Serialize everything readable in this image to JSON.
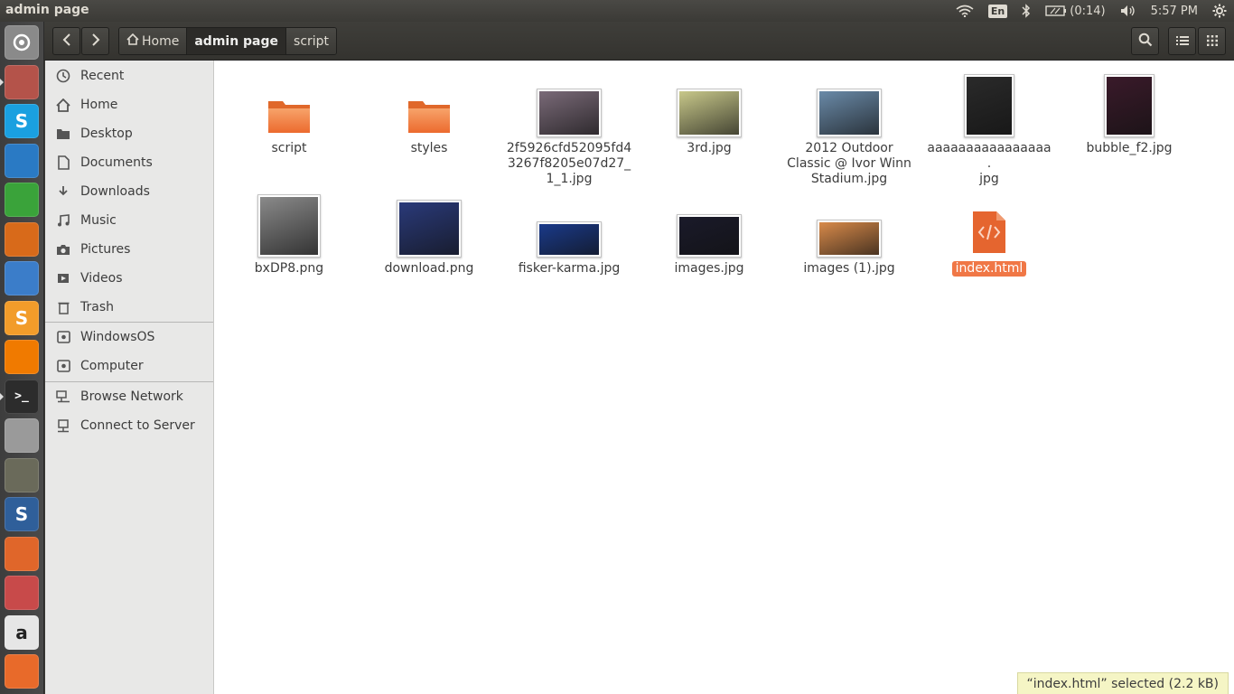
{
  "window": {
    "title": "admin page"
  },
  "panel": {
    "keyboard": "En",
    "battery": "(0:14)",
    "clock": "5:57 PM",
    "icons": [
      "wifi-icon",
      "keyboard-layout-indicator",
      "bluetooth-icon",
      "battery-icon",
      "volume-icon",
      "system-gear-icon"
    ]
  },
  "launcher": [
    {
      "name": "dash-home-icon",
      "color": "#8a8a8a",
      "glyph": ""
    },
    {
      "name": "files-icon",
      "color": "#b4534a",
      "glyph": ""
    },
    {
      "name": "skype-icon",
      "color": "#1aa0e0",
      "glyph": "S"
    },
    {
      "name": "writer-icon",
      "color": "#2a7ac4",
      "glyph": ""
    },
    {
      "name": "calc-icon",
      "color": "#3aa33a",
      "glyph": ""
    },
    {
      "name": "impress-icon",
      "color": "#d86a1a",
      "glyph": ""
    },
    {
      "name": "chromium-icon",
      "color": "#3b7dc9",
      "glyph": ""
    },
    {
      "name": "sublime-icon",
      "color": "#f29c2a",
      "glyph": "S"
    },
    {
      "name": "vlc-icon",
      "color": "#f07a00",
      "glyph": ""
    },
    {
      "name": "terminal-icon",
      "color": "#2c2c2c",
      "glyph": ""
    },
    {
      "name": "drive-icon",
      "color": "#9a9a9a",
      "glyph": ""
    },
    {
      "name": "gimp-icon",
      "color": "#6a6a5a",
      "glyph": ""
    },
    {
      "name": "software-s-icon",
      "color": "#2f5f9a",
      "glyph": "S"
    },
    {
      "name": "firefox-icon",
      "color": "#e0662a",
      "glyph": ""
    },
    {
      "name": "settings-icon",
      "color": "#c84a4a",
      "glyph": ""
    },
    {
      "name": "amazon-icon",
      "color": "#e6e6e6",
      "glyph": "a"
    },
    {
      "name": "software-center-icon",
      "color": "#e86a2a",
      "glyph": ""
    }
  ],
  "path": {
    "home": "Home",
    "current": "admin page",
    "next": "script"
  },
  "sidebar": {
    "places": [
      {
        "label": "Recent",
        "icon": "clock-icon"
      },
      {
        "label": "Home",
        "icon": "home-icon"
      },
      {
        "label": "Desktop",
        "icon": "folder-icon"
      },
      {
        "label": "Documents",
        "icon": "document-icon"
      },
      {
        "label": "Downloads",
        "icon": "download-icon"
      },
      {
        "label": "Music",
        "icon": "music-icon"
      },
      {
        "label": "Pictures",
        "icon": "camera-icon"
      },
      {
        "label": "Videos",
        "icon": "video-icon"
      },
      {
        "label": "Trash",
        "icon": "trash-icon"
      }
    ],
    "devices": [
      {
        "label": "WindowsOS",
        "icon": "drive-icon"
      },
      {
        "label": "Computer",
        "icon": "drive-icon"
      }
    ],
    "network": [
      {
        "label": "Browse Network",
        "icon": "network-icon"
      },
      {
        "label": "Connect to Server",
        "icon": "server-icon"
      }
    ]
  },
  "files": [
    {
      "name": "script",
      "type": "folder"
    },
    {
      "name": "styles",
      "type": "folder"
    },
    {
      "name": "2f5926cfd52095fd4\n3267f8205e07d27_\n1_1.jpg",
      "type": "image",
      "color": "#7a6a78"
    },
    {
      "name": "3rd.jpg",
      "type": "image",
      "color": "#c8c88a"
    },
    {
      "name": "2012 Outdoor\nClassic @ Ivor Winn\nStadium.jpg",
      "type": "image",
      "color": "#6a8aa8"
    },
    {
      "name": "aaaaaaaaaaaaaaaa.\njpg",
      "type": "image",
      "color": "#2a2a2a"
    },
    {
      "name": "bubble_f2.jpg",
      "type": "image",
      "color": "#3a1a2a"
    },
    {
      "name": "bxDP8.png",
      "type": "image",
      "color": "#8a8a8a"
    },
    {
      "name": "download.png",
      "type": "image",
      "color": "#2a3a7a"
    },
    {
      "name": "fisker-karma.jpg",
      "type": "image",
      "color": "#1a3a8a"
    },
    {
      "name": "images.jpg",
      "type": "image",
      "color": "#1a1a2a"
    },
    {
      "name": "images (1).jpg",
      "type": "image",
      "color": "#d88a4a"
    },
    {
      "name": "index.html",
      "type": "html",
      "selected": true
    }
  ],
  "status": "“index.html” selected  (2.2 kB)"
}
